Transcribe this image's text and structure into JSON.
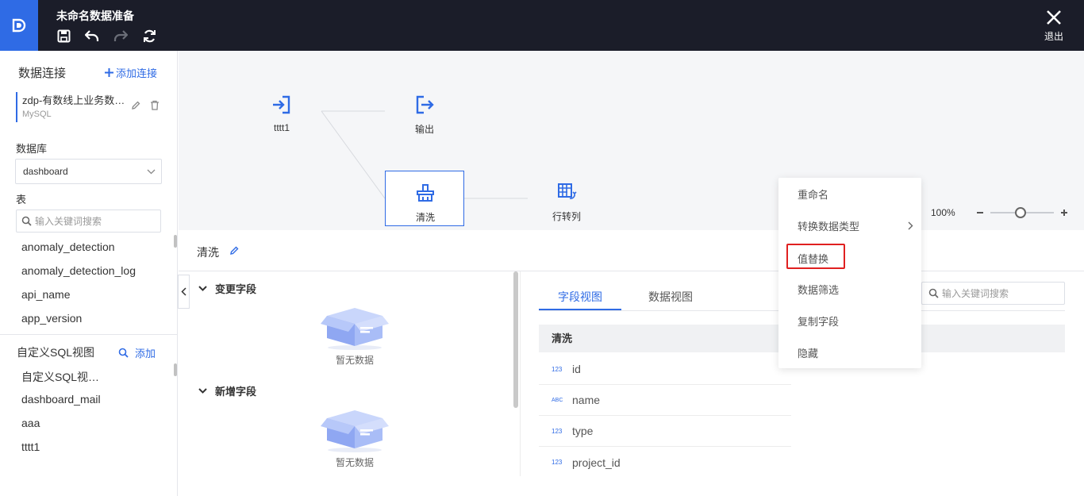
{
  "header": {
    "title": "未命名数据准备",
    "exit_label": "退出"
  },
  "sidebar": {
    "connections_title": "数据连接",
    "add_connection": "添加连接",
    "connection": {
      "name": "zdp-有数线上业务数…",
      "type": "MySQL"
    },
    "database_label": "数据库",
    "database_value": "dashboard",
    "table_label": "表",
    "table_search_placeholder": "输入关键词搜索",
    "tables": [
      "anomaly_detection",
      "anomaly_detection_log",
      "api_name",
      "app_version"
    ],
    "sql_title": "自定义SQL视图",
    "sql_add": "添加",
    "sql_views": [
      "自定义SQL视…",
      "dashboard_mail",
      "aaa",
      "tttt1"
    ]
  },
  "canvas": {
    "nodes": {
      "input": "tttt1",
      "output": "输出",
      "clean": "清洗",
      "pivot": "行转列"
    },
    "zoom": "100%"
  },
  "panel": {
    "title": "清洗",
    "changed_fields": "变更字段",
    "added_fields": "新增字段",
    "empty_text": "暂无数据",
    "tabs": [
      "字段视图",
      "数据视图"
    ],
    "field_search_placeholder": "输入关键词搜索",
    "table_header": "清洗",
    "fields": [
      {
        "type": "123",
        "name": "id"
      },
      {
        "type": "ABC",
        "name": "name"
      },
      {
        "type": "123",
        "name": "type"
      },
      {
        "type": "123",
        "name": "project_id"
      }
    ]
  },
  "context_menu": {
    "items": [
      "重命名",
      "转换数据类型",
      "值替换",
      "数据筛选",
      "复制字段",
      "隐藏"
    ],
    "highlighted": "值替换"
  },
  "colors": {
    "accent": "#2f6be5",
    "header_bg": "#1b1d29",
    "highlight": "#e02020"
  }
}
